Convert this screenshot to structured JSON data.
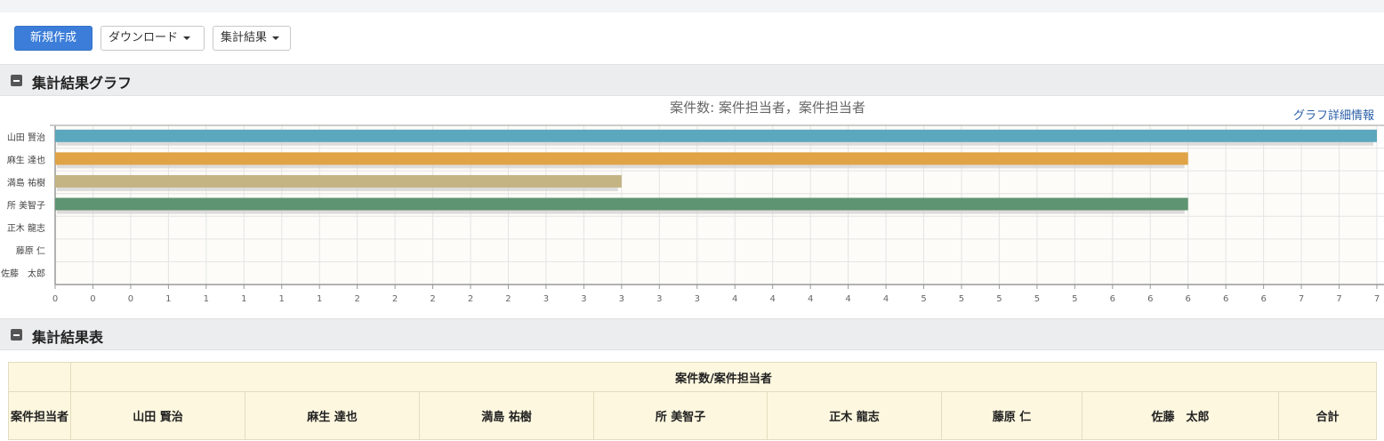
{
  "toolbar": {
    "new_label": "新規作成",
    "download_label": "ダウンロード",
    "summary_label": "集計結果"
  },
  "sections": {
    "graph_title": "集計結果グラフ",
    "table_title": "集計結果表"
  },
  "chart_link": "グラフ詳細情報",
  "chart_data": {
    "type": "bar",
    "orientation": "horizontal",
    "title": "案件数: 案件担当者，案件担当者",
    "categories": [
      "山田 賢治",
      "麻生 達也",
      "満島 祐樹",
      "所 美智子",
      "正木 龍志",
      "藤原 仁",
      "佐藤　太郎"
    ],
    "values": [
      7,
      6,
      3,
      6,
      0,
      0,
      0
    ],
    "colors": [
      "#5ba7bd",
      "#e0a345",
      "#c4b483",
      "#5f9472",
      "#cccccc",
      "#cccccc",
      "#cccccc"
    ],
    "xlim": [
      0,
      7
    ],
    "x_tick_labels": [
      "0",
      "0",
      "0",
      "1",
      "1",
      "1",
      "1",
      "1",
      "2",
      "2",
      "2",
      "2",
      "2",
      "3",
      "3",
      "3",
      "3",
      "3",
      "4",
      "4",
      "4",
      "4",
      "4",
      "5",
      "5",
      "5",
      "5",
      "5",
      "6",
      "6",
      "6",
      "6",
      "6",
      "7",
      "7",
      "7"
    ],
    "grid": true
  },
  "table": {
    "row_header": "案件担当者",
    "group_header": "案件数/案件担当者",
    "columns": [
      "山田 賢治",
      "麻生 達也",
      "満島 祐樹",
      "所 美智子",
      "正木 龍志",
      "藤原 仁",
      "佐藤　太郎",
      "合計"
    ]
  }
}
